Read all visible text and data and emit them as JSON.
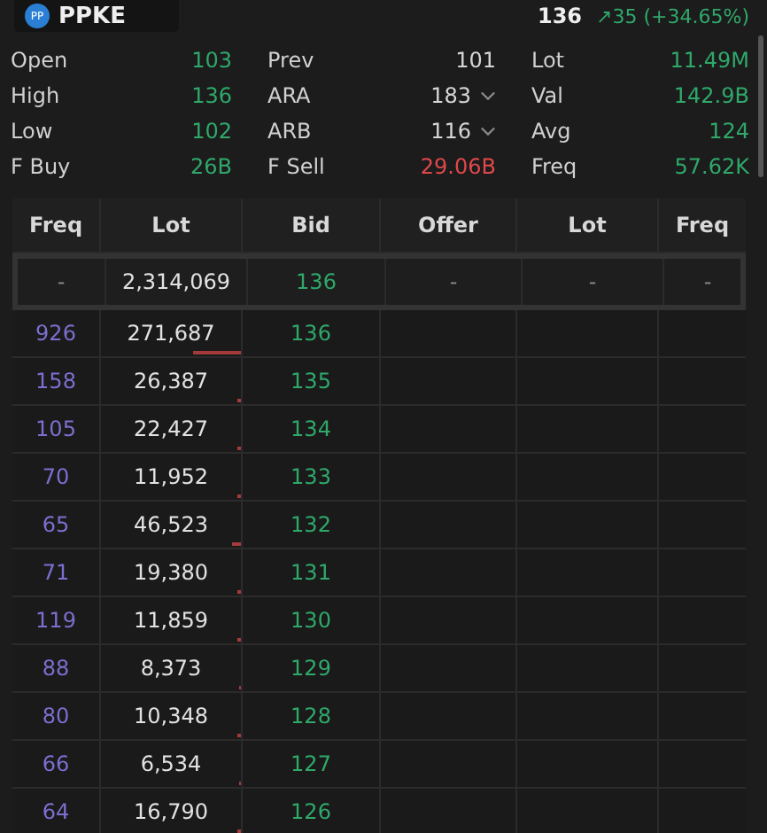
{
  "header": {
    "ticker": "PPKE",
    "logo": "PP",
    "price": "136",
    "change": "↗35 (+34.65%)"
  },
  "stats": [
    [
      {
        "label": "Open",
        "value": "103",
        "color": "#2fa86a"
      },
      {
        "label": "Prev",
        "value": "101",
        "color": "#d6d6d6"
      },
      {
        "label": "Lot",
        "value": "11.49M",
        "color": "#2fa86a"
      }
    ],
    [
      {
        "label": "High",
        "value": "136",
        "color": "#2fa86a"
      },
      {
        "label": "ARA",
        "value": "183",
        "color": "#d6d6d6",
        "dropdown": true
      },
      {
        "label": "Val",
        "value": "142.9B",
        "color": "#2fa86a"
      }
    ],
    [
      {
        "label": "Low",
        "value": "102",
        "color": "#2fa86a"
      },
      {
        "label": "ARB",
        "value": "116",
        "color": "#d6d6d6",
        "dropdown": true
      },
      {
        "label": "Avg",
        "value": "124",
        "color": "#2fa86a"
      }
    ],
    [
      {
        "label": "F Buy",
        "value": "26B",
        "color": "#2fa86a"
      },
      {
        "label": "F Sell",
        "value": "29.06B",
        "color": "#e0484a"
      },
      {
        "label": "Freq",
        "value": "57.62K",
        "color": "#2fa86a"
      }
    ]
  ],
  "table": {
    "columns": [
      "Freq",
      "Lot",
      "Bid",
      "Offer",
      "Lot",
      "Freq"
    ],
    "summary": [
      "-",
      "2,314,069",
      "136",
      "-",
      "-",
      "-"
    ],
    "rows": [
      {
        "freq": "926",
        "lot": "271,687",
        "bid": "136",
        "level": 0.34
      },
      {
        "freq": "158",
        "lot": "26,387",
        "bid": "135",
        "level": 0.03
      },
      {
        "freq": "105",
        "lot": "22,427",
        "bid": "134",
        "level": 0.03
      },
      {
        "freq": "70",
        "lot": "11,952",
        "bid": "133",
        "level": 0.02
      },
      {
        "freq": "65",
        "lot": "46,523",
        "bid": "132",
        "level": 0.06
      },
      {
        "freq": "71",
        "lot": "19,380",
        "bid": "131",
        "level": 0.02
      },
      {
        "freq": "119",
        "lot": "11,859",
        "bid": "130",
        "level": 0.02
      },
      {
        "freq": "88",
        "lot": "8,373",
        "bid": "129",
        "level": 0.01
      },
      {
        "freq": "80",
        "lot": "10,348",
        "bid": "128",
        "level": 0.02
      },
      {
        "freq": "66",
        "lot": "6,534",
        "bid": "127",
        "level": 0.01
      },
      {
        "freq": "64",
        "lot": "16,790",
        "bid": "126",
        "level": 0.03
      }
    ]
  }
}
